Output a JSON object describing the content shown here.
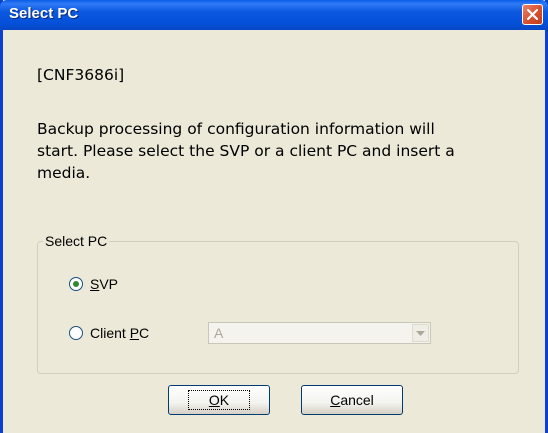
{
  "window": {
    "title": "Select PC",
    "close_icon": "close-icon"
  },
  "message": {
    "code": "[CNF3686i]",
    "body": "Backup processing of configuration information will\nstart. Please select the SVP or a client PC and insert a\nmedia."
  },
  "group": {
    "legend": "Select PC",
    "options": [
      {
        "mnemonic_prefix": "",
        "mnemonic": "S",
        "rest": "VP",
        "checked": true
      },
      {
        "mnemonic_prefix": "Client ",
        "mnemonic": "P",
        "rest": "C",
        "checked": false
      }
    ],
    "client_pc_select": {
      "value": "A",
      "enabled": false
    }
  },
  "buttons": {
    "ok": {
      "mnemonic": "O",
      "rest": "K"
    },
    "cancel": {
      "mnemonic": "C",
      "rest": "ancel"
    }
  }
}
